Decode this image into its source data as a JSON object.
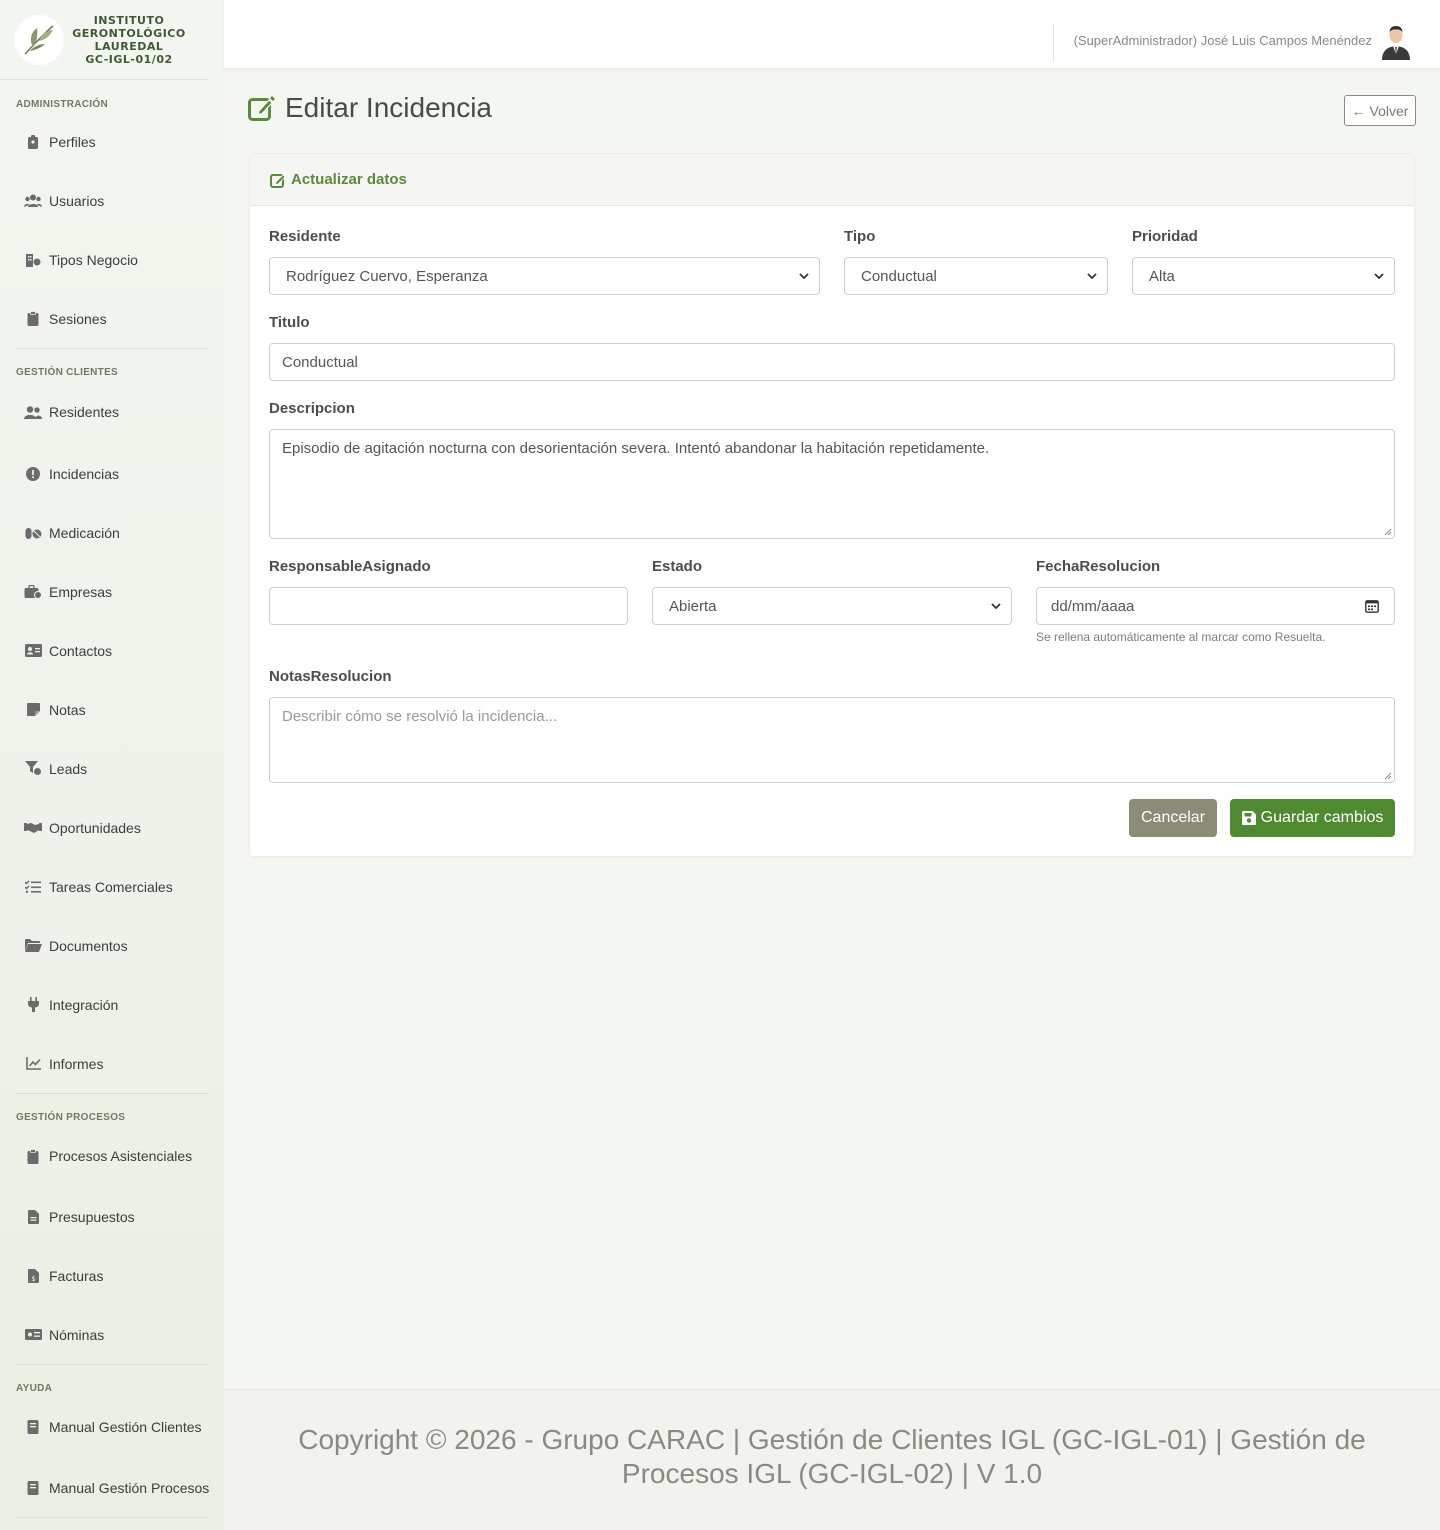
{
  "brand": {
    "line1": "INSTITUTO",
    "line2": "GERONTOLÓGICO",
    "line3": "LAUREDAL",
    "line4": "GC-IGL-01/02"
  },
  "sidebar": {
    "sections": [
      {
        "title": "ADMINISTRACIÓN",
        "items": [
          {
            "label": "Perfiles",
            "icon": "badge-icon"
          },
          {
            "label": "Usuarios",
            "icon": "users-icon"
          },
          {
            "label": "Tipos Negocio",
            "icon": "business-icon"
          },
          {
            "label": "Sesiones",
            "icon": "clipboard-icon"
          }
        ]
      },
      {
        "title": "GESTIÓN CLIENTES",
        "items": [
          {
            "label": "Residentes",
            "icon": "user-group-icon"
          },
          {
            "label": "Incidencias",
            "icon": "alert-circle-icon"
          },
          {
            "label": "Medicación",
            "icon": "pills-icon"
          },
          {
            "label": "Empresas",
            "icon": "briefcase-icon"
          },
          {
            "label": "Contactos",
            "icon": "address-card-icon"
          },
          {
            "label": "Notas",
            "icon": "note-icon"
          },
          {
            "label": "Leads",
            "icon": "funnel-icon"
          },
          {
            "label": "Oportunidades",
            "icon": "handshake-icon"
          },
          {
            "label": "Tareas Comerciales",
            "icon": "tasks-icon"
          },
          {
            "label": "Documentos",
            "icon": "folder-icon"
          },
          {
            "label": "Integración",
            "icon": "plug-icon"
          },
          {
            "label": "Informes",
            "icon": "chart-line-icon"
          }
        ]
      },
      {
        "title": "GESTIÓN PROCESOS",
        "items": [
          {
            "label": "Procesos Asistenciales",
            "icon": "clipboard-icon"
          },
          {
            "label": "Presupuestos",
            "icon": "file-icon"
          },
          {
            "label": "Facturas",
            "icon": "invoice-icon"
          },
          {
            "label": "Nóminas",
            "icon": "money-icon"
          }
        ]
      },
      {
        "title": "AYUDA",
        "items": [
          {
            "label": "Manual Gestión Clientes",
            "icon": "book-icon"
          },
          {
            "label": "Manual Gestión Procesos",
            "icon": "book-icon"
          }
        ]
      }
    ]
  },
  "topbar": {
    "user": "(SuperAdministrador) José Luis Campos Menéndez"
  },
  "page": {
    "title": "Editar Incidencia",
    "back_label": "Volver"
  },
  "card": {
    "header": "Actualizar datos"
  },
  "form": {
    "residente": {
      "label": "Residente",
      "value": "Rodríguez Cuervo, Esperanza"
    },
    "tipo": {
      "label": "Tipo",
      "value": "Conductual"
    },
    "prioridad": {
      "label": "Prioridad",
      "value": "Alta"
    },
    "titulo": {
      "label": "Titulo",
      "value": "Conductual"
    },
    "descripcion": {
      "label": "Descripcion",
      "value": "Episodio de agitación nocturna con desorientación severa. Intentó abandonar la habitación repetidamente."
    },
    "responsable": {
      "label": "ResponsableAsignado",
      "value": ""
    },
    "estado": {
      "label": "Estado",
      "value": "Abierta"
    },
    "fecha": {
      "label": "FechaResolucion",
      "placeholder": "dd/mm/aaaa",
      "help": "Se rellena automáticamente al marcar como Resuelta."
    },
    "notas": {
      "label": "NotasResolucion",
      "placeholder": "Describir cómo se resolvió la incidencia..."
    },
    "cancel_label": "Cancelar",
    "save_label": "Guardar cambios"
  },
  "footer": {
    "text": "Copyright © 2026 - Grupo CARAC | Gestión de Clientes IGL (GC-IGL-01) | Gestión de Procesos IGL (GC-IGL-02) | V 1.0"
  },
  "colors": {
    "accent": "#4f8a31",
    "cancel": "#8a8c76",
    "header_text": "#5b8a3b"
  }
}
